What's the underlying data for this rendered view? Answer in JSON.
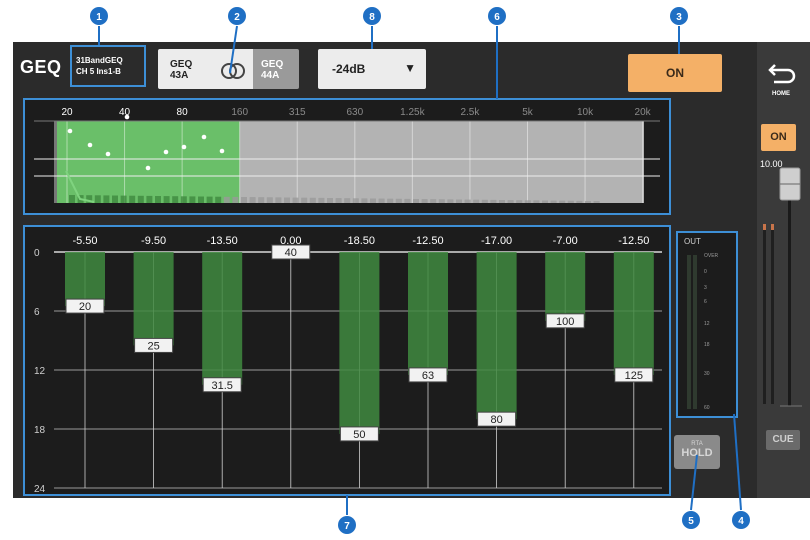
{
  "title": "GEQ",
  "channel_name": {
    "line1": "31BandGEQ",
    "line2": "CH 5 Ins1-B"
  },
  "geq_pair": {
    "a_label": "GEQ",
    "a_id": "43A",
    "b_label": "GEQ",
    "b_id": "44A"
  },
  "range_dropdown": {
    "value": "-24dB",
    "arrow": "▼"
  },
  "on_button": "ON",
  "sidebar": {
    "home_label": "HOME",
    "on_label": "ON",
    "fader_value": "10.00",
    "cue_label": "CUE"
  },
  "rta": {
    "freq_labels": [
      "20",
      "40",
      "80",
      "160",
      "315",
      "630",
      "1.25k",
      "2.5k",
      "5k",
      "10k",
      "20k"
    ],
    "active_count": 3,
    "colors": {
      "active_fill": "#6abf69",
      "inactive_fill": "#8f8f8f",
      "bg": "#b3b3b3"
    }
  },
  "eq_bands": {
    "gain_labels": [
      "-5.50",
      "-9.50",
      "-13.50",
      "0.00",
      "-18.50",
      "-12.50",
      "-17.00",
      "-7.00",
      "-12.50"
    ],
    "gains": [
      5.5,
      9.5,
      13.5,
      0.0,
      18.5,
      12.5,
      17.0,
      7.0,
      12.5
    ],
    "freq_labels": [
      "20",
      "25",
      "31.5",
      "40",
      "50",
      "63",
      "80",
      "100",
      "125"
    ],
    "y_ticks": [
      "0",
      "6",
      "12",
      "18",
      "24"
    ],
    "max_db": 24
  },
  "meter": {
    "title": "OUT",
    "scale": [
      "OVER",
      "0",
      "3",
      "6",
      "12",
      "18",
      "30",
      "60"
    ]
  },
  "rta_hold": {
    "line1": "RTA",
    "line2": "HOLD"
  },
  "callouts": [
    "1",
    "2",
    "8",
    "6",
    "3",
    "7",
    "5",
    "4"
  ],
  "colors": {
    "accent_orange": "#f4b067",
    "callout_blue": "#1f6fc4",
    "band_green": "#3f8a3f"
  }
}
